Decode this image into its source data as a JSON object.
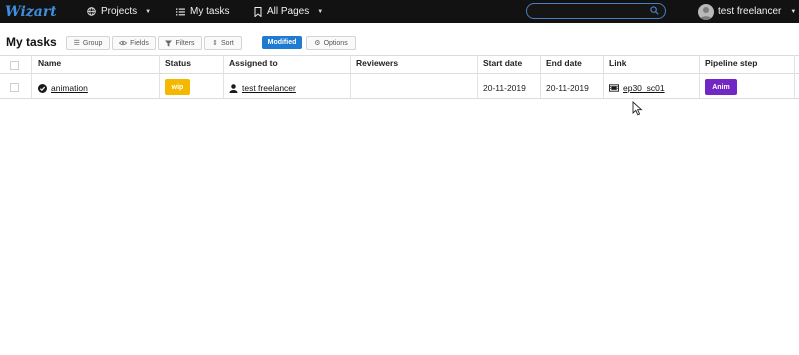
{
  "app": {
    "logo_text": "Wizart"
  },
  "nav": {
    "projects_label": "Projects",
    "my_tasks_label": "My tasks",
    "all_pages_label": "All Pages"
  },
  "search": {
    "placeholder": "",
    "value": ""
  },
  "user": {
    "name": "test freelancer"
  },
  "page": {
    "title": "My tasks"
  },
  "toolbar": {
    "group_label": "Group",
    "fields_label": "Fields",
    "filters_label": "Filters",
    "sort_label": "Sort",
    "modified_label": "Modified",
    "options_label": "Options"
  },
  "table": {
    "columns": [
      "Name",
      "Status",
      "Assigned to",
      "Reviewers",
      "Start date",
      "End date",
      "Link",
      "Pipeline step"
    ],
    "rows": [
      {
        "name": "animation",
        "status": "wip",
        "assigned_to": "test freelancer",
        "reviewers": "",
        "start_date": "20-11-2019",
        "end_date": "20-11-2019",
        "link": "ep30_sc01",
        "pipeline_step": "Anim"
      }
    ]
  },
  "colors": {
    "nav_bg": "#121212",
    "accent_blue": "#1f7ad1",
    "status_wip": "#f5b800",
    "step_anim": "#7226c4"
  }
}
